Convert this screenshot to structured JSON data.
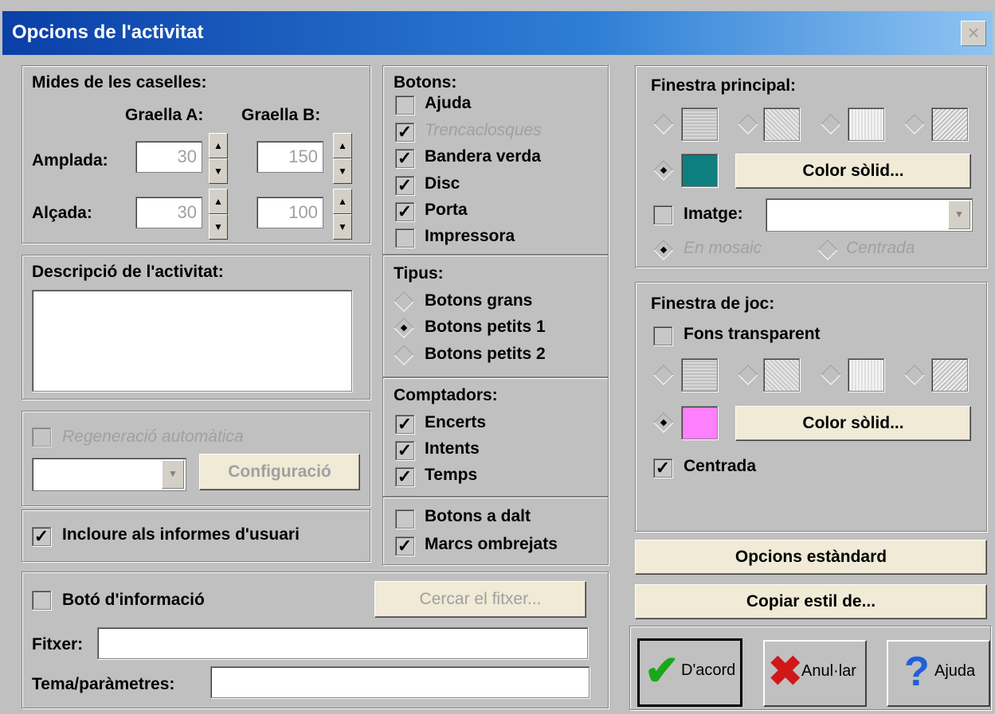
{
  "title": "Opcions de l'activitat",
  "close_glyph": "×",
  "sizes": {
    "heading": "Mides de les caselles:",
    "grid_a": "Graella A:",
    "grid_b": "Graella B:",
    "width_label": "Amplada:",
    "height_label": "Alçada:",
    "a_width": "30",
    "b_width": "150",
    "a_height": "30",
    "b_height": "100"
  },
  "description": {
    "heading": "Descripció de l'activitat:",
    "value": ""
  },
  "regen": {
    "label": "Regeneració automàtica",
    "config_label": "Configuració"
  },
  "include_reports": "Incloure als informes d'usuari",
  "info": {
    "button_label": "Botó d'informació",
    "search_label": "Cercar el fitxer...",
    "file_label": "Fitxer:",
    "theme_label": "Tema/paràmetres:",
    "file_value": "",
    "theme_value": ""
  },
  "buttons": {
    "heading": "Botons:",
    "items": [
      {
        "label": "Ajuda",
        "checked": false,
        "disabled": false
      },
      {
        "label": "Trencaclosques",
        "checked": true,
        "disabled": true
      },
      {
        "label": "Bandera verda",
        "checked": true,
        "disabled": false
      },
      {
        "label": "Disc",
        "checked": true,
        "disabled": false
      },
      {
        "label": "Porta",
        "checked": true,
        "disabled": false
      },
      {
        "label": "Impressora",
        "checked": false,
        "disabled": false
      }
    ]
  },
  "types": {
    "heading": "Tipus:",
    "items": [
      {
        "label": "Botons grans",
        "selected": false
      },
      {
        "label": "Botons petits 1",
        "selected": true
      },
      {
        "label": "Botons petits 2",
        "selected": false
      }
    ]
  },
  "counters": {
    "heading": "Comptadors:",
    "items": [
      {
        "label": "Encerts",
        "checked": true
      },
      {
        "label": "Intents",
        "checked": true
      },
      {
        "label": "Temps",
        "checked": true
      }
    ]
  },
  "layout_opts": {
    "items": [
      {
        "label": "Botons a dalt",
        "checked": false
      },
      {
        "label": "Marcs ombrejats",
        "checked": true
      }
    ]
  },
  "main_window": {
    "heading": "Finestra principal:",
    "color_button": "Color sòlid...",
    "color": "#0e7f7f",
    "image_label": "Imatge:",
    "mosaic_label": "En mosaic",
    "centered_label": "Centrada"
  },
  "game_window": {
    "heading": "Finestra de joc:",
    "transparent_label": "Fons transparent",
    "color_button": "Color sòlid...",
    "color": "#ff80ff",
    "centered_label": "Centrada"
  },
  "standard_options": "Opcions estàndard",
  "copy_style": "Copiar estil de...",
  "ok_label": "D'acord",
  "cancel_label": "Anul·lar",
  "help_label": "Ajuda",
  "check_glyph": "✓"
}
